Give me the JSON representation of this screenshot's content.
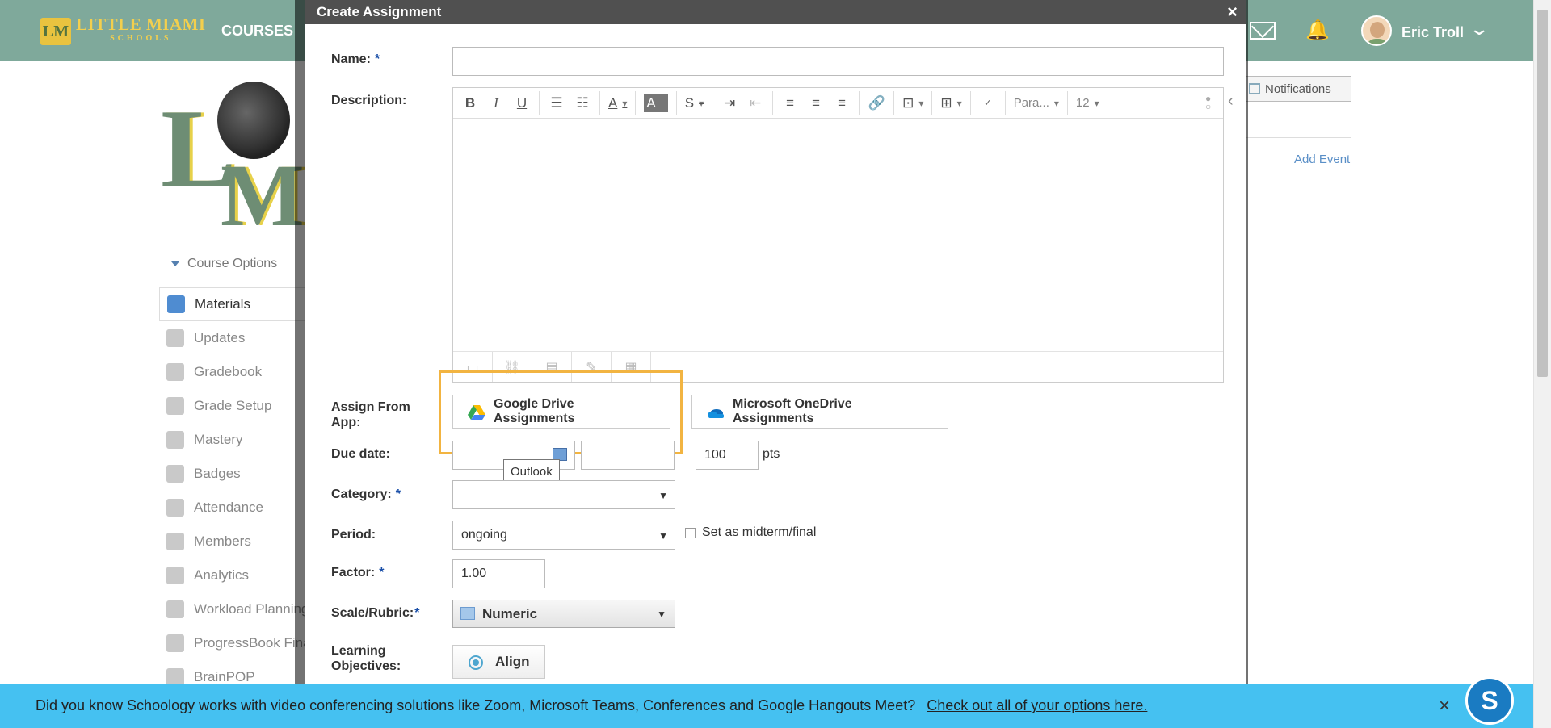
{
  "topnav": {
    "logo_mark": "LM",
    "logo_text": "LITTLE MIAMI",
    "logo_subtext": "SCHOOLS",
    "courses_label": "COURSES",
    "user_name": "Eric Troll"
  },
  "sidebar": {
    "course_options_label": "Course Options",
    "items": [
      {
        "label": "Materials",
        "icon": "materials-icon"
      },
      {
        "label": "Updates",
        "icon": "updates-icon"
      },
      {
        "label": "Gradebook",
        "icon": "gradebook-icon"
      },
      {
        "label": "Grade Setup",
        "icon": "grade-setup-icon"
      },
      {
        "label": "Mastery",
        "icon": "mastery-icon"
      },
      {
        "label": "Badges",
        "icon": "badges-icon"
      },
      {
        "label": "Attendance",
        "icon": "attendance-icon"
      },
      {
        "label": "Members",
        "icon": "members-icon"
      },
      {
        "label": "Analytics",
        "icon": "analytics-icon"
      },
      {
        "label": "Workload Planning",
        "icon": "workload-icon"
      },
      {
        "label": "ProgressBook Final",
        "icon": "progressbook-icon"
      },
      {
        "label": "BrainPOP",
        "icon": "brainpop-icon"
      }
    ]
  },
  "right_col": {
    "notifications_label": "Notifications",
    "add_event_label": "Add Event"
  },
  "modal": {
    "title": "Create Assignment",
    "close_glyph": "×",
    "name_label": "Name:",
    "required_mark": "*",
    "name_value": "",
    "description_label": "Description:",
    "editor": {
      "paragraph_label": "Para...",
      "font_size": "12"
    },
    "assign_from_app_label": "Assign From App:",
    "google_drive_label": "Google Drive Assignments",
    "onedrive_label": "Microsoft OneDrive Assignments",
    "due_date_label": "Due date:",
    "due_date_value": "",
    "due_time_value": "",
    "points_value": "100",
    "points_unit": "pts",
    "tooltip_text": "Outlook",
    "category_label": "Category:",
    "category_value": "",
    "period_label": "Period:",
    "period_value": "ongoing",
    "midterm_label": "Set as midterm/final",
    "factor_label": "Factor:",
    "factor_value": "1.00",
    "scale_label": "Scale/Rubric:",
    "scale_value": "Numeric",
    "learning_objectives_label": "Learning Objectives:",
    "align_label": "Align"
  },
  "banner": {
    "text": "Did you know Schoology works with video conferencing solutions like Zoom, Microsoft Teams, Conferences and Google Hangouts Meet?",
    "link": "Check out all of your options here.",
    "close_glyph": "×",
    "chat_letter": "S"
  },
  "colors": {
    "topnav": "#7fa99b",
    "banner": "#45c1f1",
    "highlight": "#f2b441",
    "required": "#1a4fa8"
  }
}
